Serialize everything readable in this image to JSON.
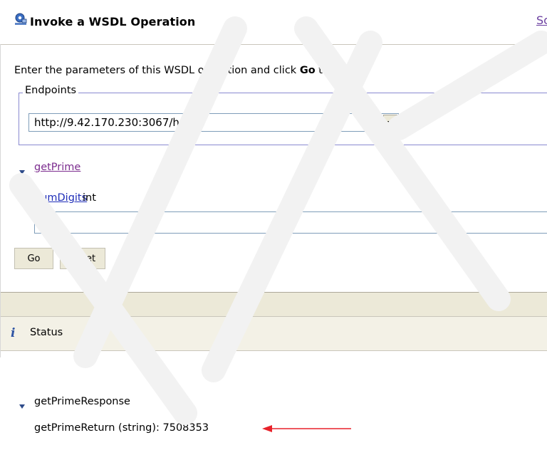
{
  "title": {
    "text": "Invoke a WSDL Operation",
    "link": "Sc",
    "icon": "gear-web-service-icon"
  },
  "instruction": {
    "before": "Enter the parameters of this WSDL operation and click ",
    "bold": "Go",
    "after": " to invoke."
  },
  "endpoints": {
    "legend": "Endpoints",
    "selected": "http://9.42.170.230:3067/hello"
  },
  "operation": {
    "name": "getPrime",
    "param_name": "numDigits",
    "param_type": "int",
    "param_value": "7"
  },
  "buttons": {
    "go": "Go",
    "reset": "Reset"
  },
  "status": {
    "label": "Status",
    "icon": "info-icon",
    "response_name": "getPrimeResponse",
    "response_line": "getPrimeReturn (string): 7508353"
  },
  "colors": {
    "visited_link": "#7b2b8e",
    "link": "#1e2db8",
    "annotation_arrow": "#e8222a",
    "band": "#ece9d8"
  }
}
